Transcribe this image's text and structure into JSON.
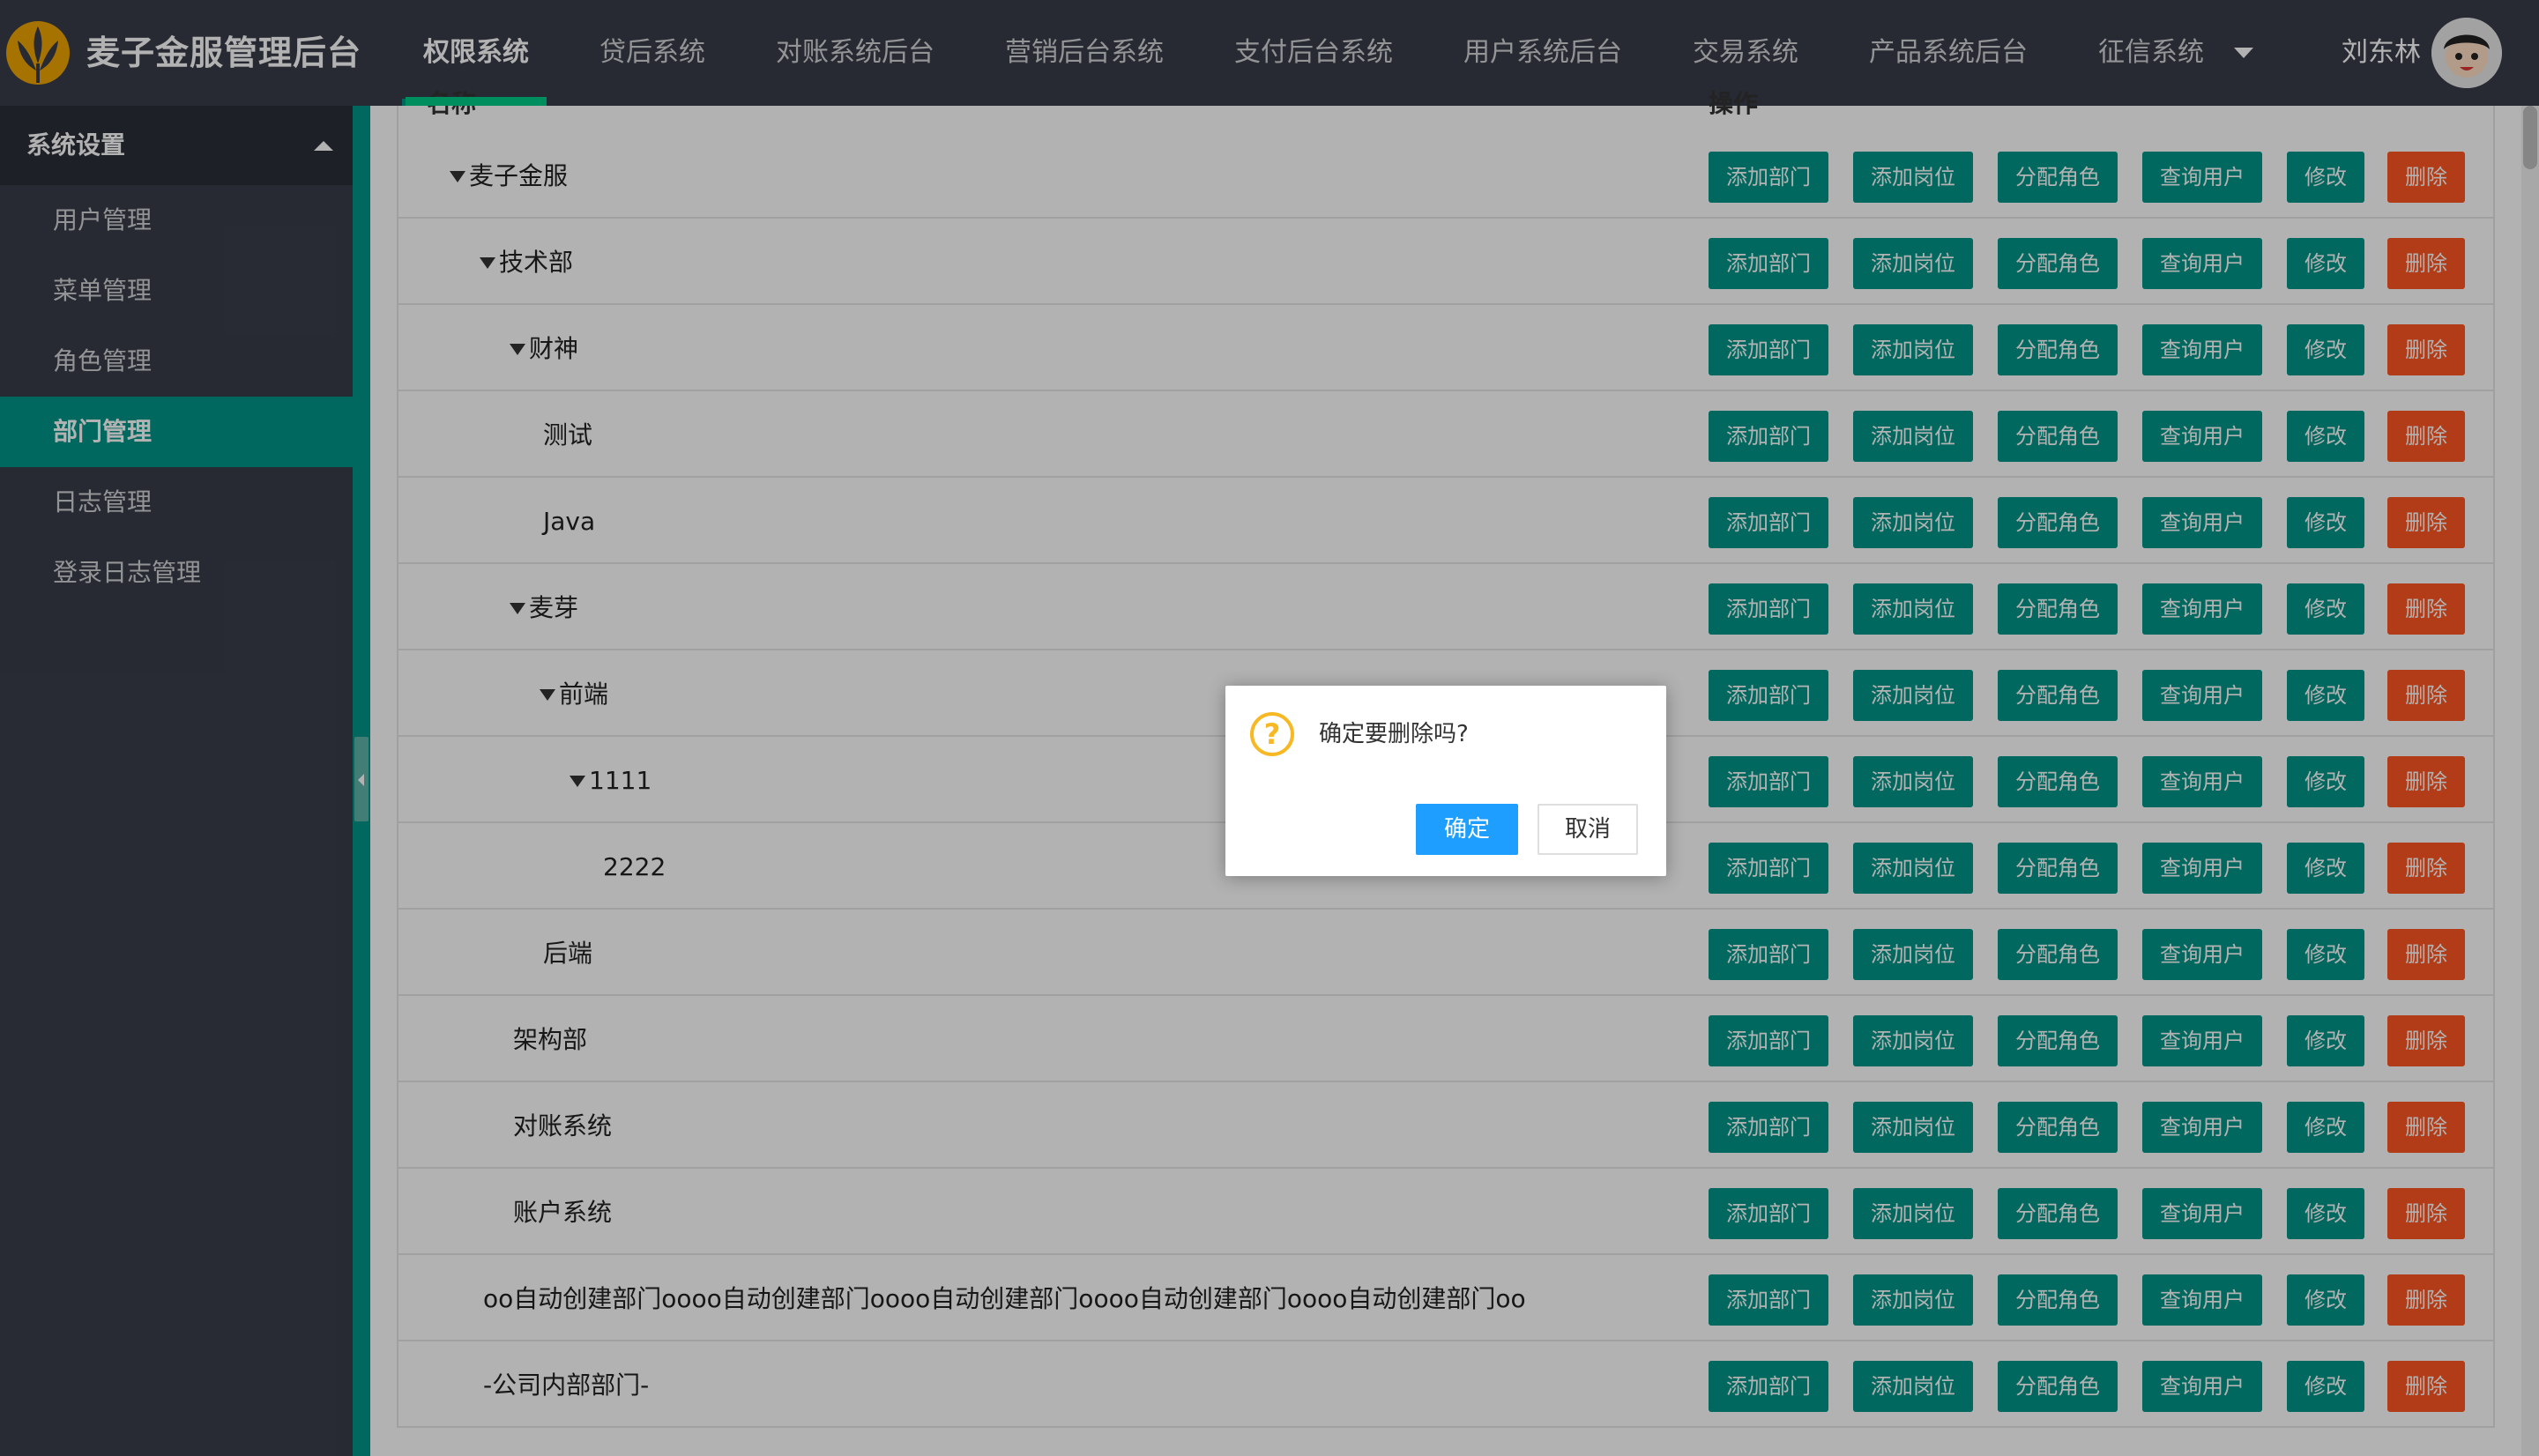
{
  "app": {
    "brand": "麦子金服管理后台"
  },
  "nav": {
    "items": [
      "权限系统",
      "贷后系统",
      "对账系统后台",
      "营销后台系统",
      "支付后台系统",
      "用户系统后台",
      "交易系统",
      "产品系统后台",
      "征信系统"
    ],
    "active_index": 0
  },
  "user": {
    "name": "刘东林"
  },
  "sidebar": {
    "header": "系统设置",
    "items": [
      "用户管理",
      "菜单管理",
      "角色管理",
      "部门管理",
      "日志管理",
      "登录日志管理"
    ],
    "active_index": 3
  },
  "table": {
    "header_name": "名称",
    "header_ops": "操作",
    "buttons": [
      "添加部门",
      "添加岗位",
      "分配角色",
      "查询用户",
      "修改",
      "删除"
    ],
    "rows": [
      {
        "name": "麦子金服",
        "level": 0,
        "expanded": true
      },
      {
        "name": "技术部",
        "level": 1,
        "expanded": true
      },
      {
        "name": "财神",
        "level": 2,
        "expanded": true
      },
      {
        "name": "测试",
        "level": 3,
        "expanded": false
      },
      {
        "name": "Java",
        "level": 3,
        "expanded": false
      },
      {
        "name": "麦芽",
        "level": 2,
        "expanded": true
      },
      {
        "name": "前端",
        "level": 3,
        "expanded": true
      },
      {
        "name": "1111",
        "level": 4,
        "expanded": true
      },
      {
        "name": "2222",
        "level": 5,
        "expanded": false
      },
      {
        "name": "后端",
        "level": 3,
        "expanded": false
      },
      {
        "name": "架构部",
        "level": 2,
        "expanded": false
      },
      {
        "name": "对账系统",
        "level": 2,
        "expanded": false
      },
      {
        "name": "账户系统",
        "level": 2,
        "expanded": false
      },
      {
        "name": "oo自动创建部门oooo自动创建部门oooo自动创建部门oooo自动创建部门oooo自动创建部门oo",
        "level": 1,
        "expanded": false
      },
      {
        "name": "-公司内部部门-",
        "level": 1,
        "expanded": false
      }
    ]
  },
  "dialog": {
    "icon": "question-icon",
    "message": "确定要删除吗?",
    "ok_label": "确定",
    "cancel_label": "取消"
  },
  "colors": {
    "header_bg": "#393d49",
    "accent": "#009688",
    "danger": "#ff5722",
    "primary": "#1e9fff",
    "warning": "#f7b824"
  }
}
